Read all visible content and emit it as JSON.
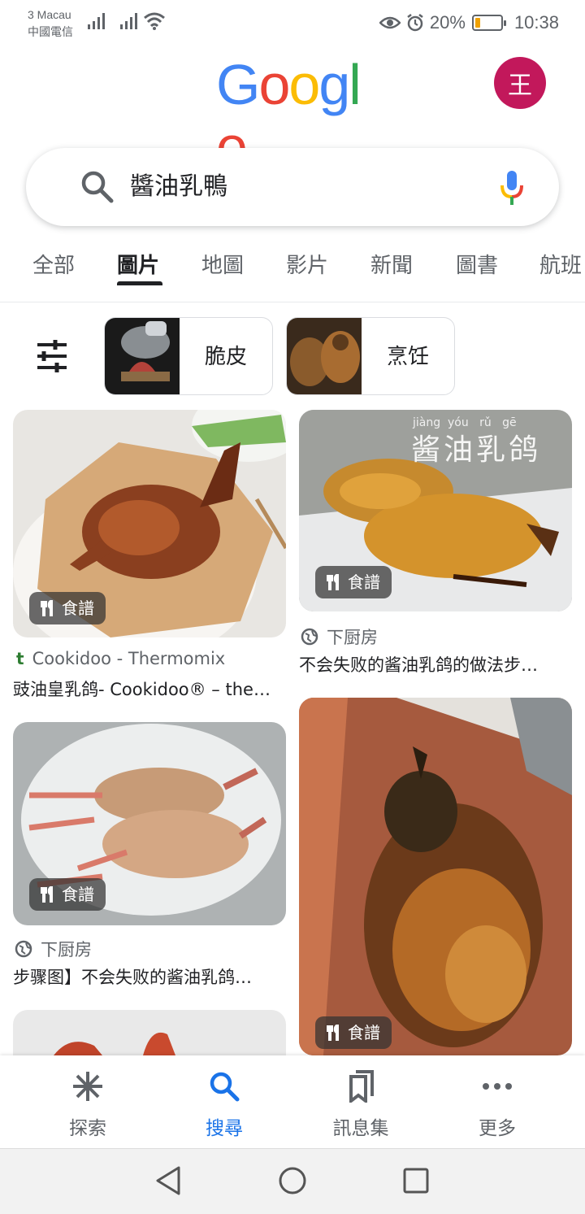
{
  "status_bar": {
    "carrier_name": "3 Macau",
    "carrier_sub": "中國電信",
    "battery_percent": "20%",
    "battery_level": 0.2,
    "time": "10:38"
  },
  "header": {
    "logo_letters": [
      "G",
      "o",
      "o",
      "g",
      "l",
      "e"
    ],
    "logo_colors": [
      "#4285F4",
      "#EA4335",
      "#FBBC05",
      "#4285F4",
      "#34A853",
      "#EA4335"
    ],
    "avatar_letter": "王",
    "avatar_color": "#c2185b"
  },
  "search": {
    "query": "醬油乳鴨"
  },
  "tabs": [
    {
      "label": "全部",
      "active": false
    },
    {
      "label": "圖片",
      "active": true
    },
    {
      "label": "地圖",
      "active": false
    },
    {
      "label": "影片",
      "active": false
    },
    {
      "label": "新聞",
      "active": false
    },
    {
      "label": "圖書",
      "active": false
    },
    {
      "label": "航班",
      "active": false
    }
  ],
  "chips": [
    {
      "label": "脆皮"
    },
    {
      "label": "烹饪"
    }
  ],
  "results": [
    {
      "badge": "食譜",
      "source": "Cookidoo - Thermomix",
      "title": "豉油皇乳鸽- Cookidoo® – the…"
    },
    {
      "badge": "食譜",
      "source": "下厨房",
      "title": "不会失败的酱油乳鸽的做法步…",
      "watermark": "酱油乳鸽",
      "pinyin": "jiàng  yóu   rǔ   gē"
    },
    {
      "badge": "食譜",
      "source": "下厨房",
      "title": "步骤图】不会失败的酱油乳鸽…"
    },
    {
      "badge": "食譜"
    }
  ],
  "bottom_nav": [
    {
      "label": "探索",
      "icon": "asterisk-icon",
      "active": false
    },
    {
      "label": "搜尋",
      "icon": "search-icon",
      "active": true
    },
    {
      "label": "訊息集",
      "icon": "collections-icon",
      "active": false
    },
    {
      "label": "更多",
      "icon": "more-dots-icon",
      "active": false
    }
  ],
  "colors": {
    "accent": "#1a73e8",
    "text_secondary": "#5f6368"
  }
}
